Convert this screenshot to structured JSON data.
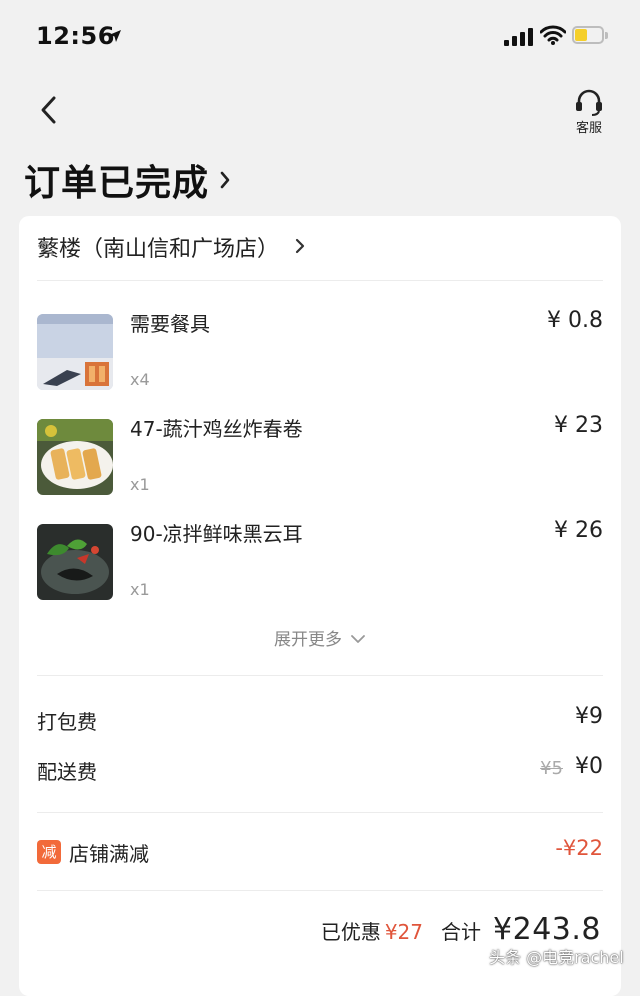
{
  "status_bar": {
    "time": "12:56",
    "location_icon": "location-arrow-icon",
    "signal_icon": "cellular-signal-icon",
    "wifi_icon": "wifi-icon",
    "battery_icon": "battery-icon",
    "battery_color": "#f5cf2a"
  },
  "header": {
    "back_icon": "chevron-left-icon",
    "customer_service_label": "客服",
    "customer_service_icon": "headset-icon"
  },
  "order_status": {
    "text": "订单已完成",
    "chevron_icon": "chevron-right-icon"
  },
  "shop": {
    "name": "蘩楼（南山信和广场店）",
    "chevron_icon": "chevron-right-icon"
  },
  "items": [
    {
      "name": "需要餐具",
      "qty": "x4",
      "price": "¥ 0.8"
    },
    {
      "name": "47-蔬汁鸡丝炸春卷",
      "qty": "x1",
      "price": "¥ 23"
    },
    {
      "name": "90-凉拌鲜味黑云耳",
      "qty": "x1",
      "price": "¥ 26"
    }
  ],
  "expand_more": {
    "label": "展开更多",
    "icon": "chevron-down-icon"
  },
  "fees": {
    "packing": {
      "label": "打包费",
      "value": "¥9"
    },
    "delivery": {
      "label": "配送费",
      "original": "¥5",
      "value": "¥0"
    }
  },
  "discount": {
    "badge": "减",
    "label": "店铺满减",
    "value": "-¥22",
    "badge_color": "#f26a3a",
    "value_color": "#e0553b"
  },
  "summary": {
    "discount_label": "已优惠",
    "discount_value": "¥27",
    "total_label": "合计",
    "total_value": "¥243.8"
  },
  "watermark": "头条 @电竞rachel"
}
